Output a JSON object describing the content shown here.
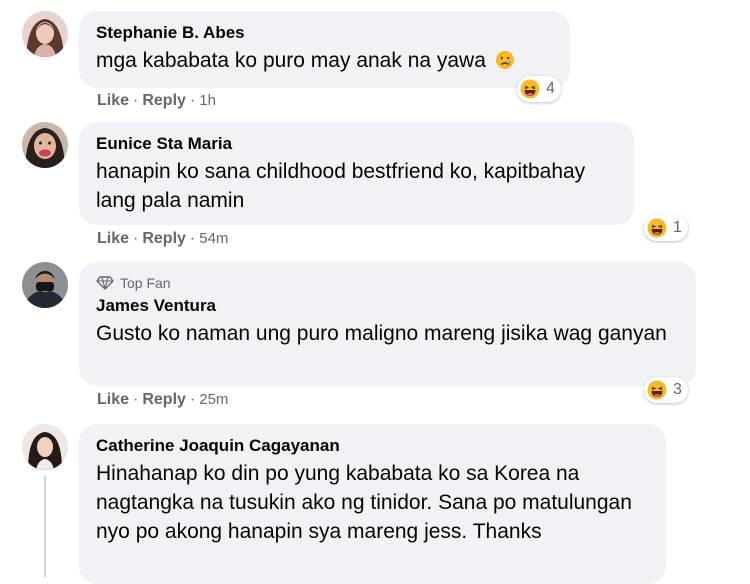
{
  "comments": [
    {
      "author": "Stephanie B. Abes",
      "text": "mga kababata ko puro may anak na yawa",
      "reaction_emoji": "sad-cry-emoji-icon",
      "reaction_icon": "haha-reaction-icon",
      "reaction_count": "4",
      "like": "Like",
      "reply": "Reply",
      "time": "1h"
    },
    {
      "author": "Eunice Sta Maria",
      "text": "hanapin ko sana childhood bestfriend ko, kapitbahay lang pala namin",
      "reaction_icon": "haha-reaction-icon",
      "reaction_count": "1",
      "like": "Like",
      "reply": "Reply",
      "time": "54m"
    },
    {
      "badge": "Top Fan",
      "author": "James Ventura",
      "text": "Gusto ko naman ung puro maligno mareng jisika wag ganyan",
      "reaction_icon": "haha-reaction-icon",
      "reaction_count": "3",
      "like": "Like",
      "reply": "Reply",
      "time": "25m"
    },
    {
      "author": "Catherine Joaquin Cagayanan",
      "text": "Hinahanap ko din po yung kababata ko sa Korea na nagtangka na tusukin ako ng tinidor. Sana po matulungan nyo po akong hanapin sya mareng jess. Thanks"
    }
  ],
  "separator": "·",
  "colors": {
    "bubble": "#f0f2f5",
    "meta_text": "#65676b",
    "haha_yellow": "#f7b928"
  }
}
